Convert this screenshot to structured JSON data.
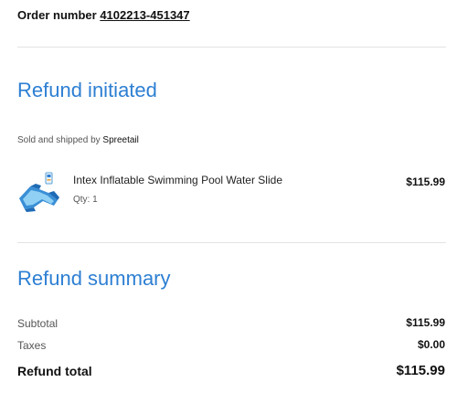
{
  "order": {
    "label": "Order number",
    "number": "4102213-451347"
  },
  "refund_initiated": {
    "title": "Refund initiated",
    "sold_by_prefix": "Sold and shipped by",
    "seller": "Spreetail",
    "item": {
      "name": "Intex Inflatable Swimming Pool Water Slide",
      "qty": "Qty: 1",
      "price": "$115.99",
      "image_icon": "water-slide-product-image"
    }
  },
  "refund_summary": {
    "title": "Refund summary",
    "subtotal_label": "Subtotal",
    "subtotal_value": "$115.99",
    "taxes_label": "Taxes",
    "taxes_value": "$0.00",
    "total_label": "Refund total",
    "total_value": "$115.99"
  },
  "colors": {
    "accent": "#2d7fd3",
    "divider": "#e3e3e3",
    "text": "#111111",
    "muted": "#555555"
  }
}
